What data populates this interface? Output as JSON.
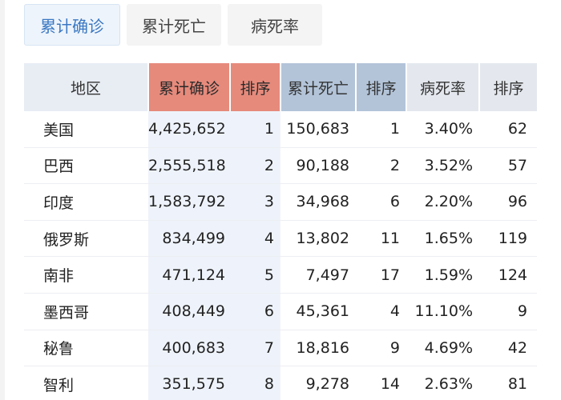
{
  "tabs": [
    {
      "label": "累计确诊",
      "active": true
    },
    {
      "label": "累计死亡",
      "active": false
    },
    {
      "label": "病死率",
      "active": false
    }
  ],
  "table": {
    "headers": {
      "region": "地区",
      "confirmed": "累计确诊",
      "rank_confirmed": "排序",
      "deaths": "累计死亡",
      "rank_deaths": "排序",
      "fatality_rate": "病死率",
      "rank_rate": "排序"
    },
    "rows": [
      {
        "region": "美国",
        "confirmed": "4,425,652",
        "rank_confirmed": "1",
        "deaths": "150,683",
        "rank_deaths": "1",
        "fatality_rate": "3.40%",
        "rank_rate": "62"
      },
      {
        "region": "巴西",
        "confirmed": "2,555,518",
        "rank_confirmed": "2",
        "deaths": "90,188",
        "rank_deaths": "2",
        "fatality_rate": "3.52%",
        "rank_rate": "57"
      },
      {
        "region": "印度",
        "confirmed": "1,583,792",
        "rank_confirmed": "3",
        "deaths": "34,968",
        "rank_deaths": "6",
        "fatality_rate": "2.20%",
        "rank_rate": "96"
      },
      {
        "region": "俄罗斯",
        "confirmed": "834,499",
        "rank_confirmed": "4",
        "deaths": "13,802",
        "rank_deaths": "11",
        "fatality_rate": "1.65%",
        "rank_rate": "119"
      },
      {
        "region": "南非",
        "confirmed": "471,124",
        "rank_confirmed": "5",
        "deaths": "7,497",
        "rank_deaths": "17",
        "fatality_rate": "1.59%",
        "rank_rate": "124"
      },
      {
        "region": "墨西哥",
        "confirmed": "408,449",
        "rank_confirmed": "6",
        "deaths": "45,361",
        "rank_deaths": "4",
        "fatality_rate": "11.10%",
        "rank_rate": "9"
      },
      {
        "region": "秘鲁",
        "confirmed": "400,683",
        "rank_confirmed": "7",
        "deaths": "18,816",
        "rank_deaths": "9",
        "fatality_rate": "4.69%",
        "rank_rate": "42"
      },
      {
        "region": "智利",
        "confirmed": "351,575",
        "rank_confirmed": "8",
        "deaths": "9,278",
        "rank_deaths": "14",
        "fatality_rate": "2.63%",
        "rank_rate": "81"
      }
    ]
  },
  "colors": {
    "active_tab_text": "#3a78c3",
    "confirmed_header": "#e68a7c",
    "deaths_header": "#b3c4d9",
    "highlight_column": "#eef3fb"
  }
}
